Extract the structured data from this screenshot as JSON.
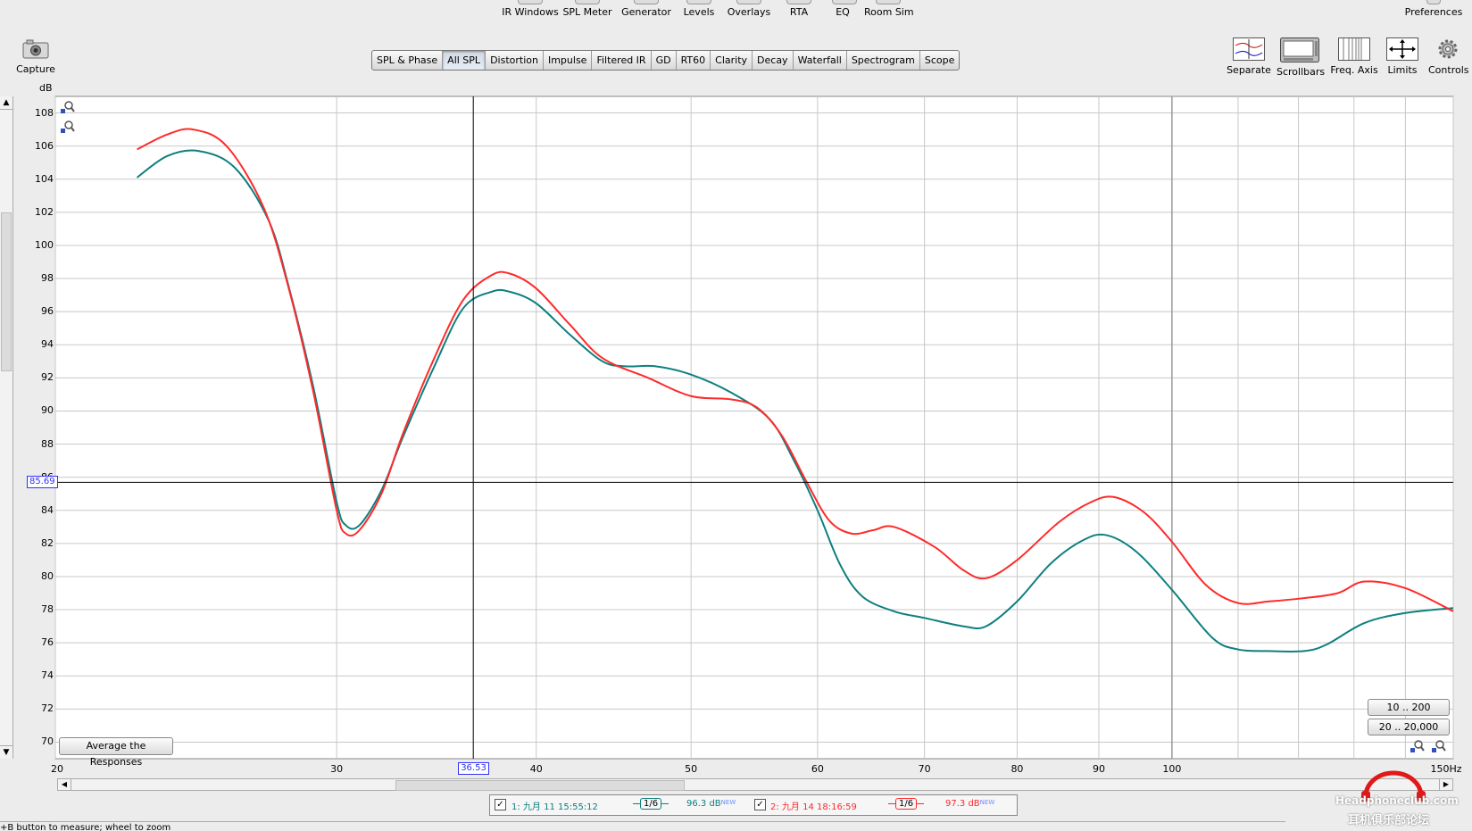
{
  "toolbar_top": {
    "items": [
      "IR Windows",
      "SPL Meter",
      "Generator",
      "Levels",
      "Overlays",
      "RTA",
      "EQ",
      "Room Sim"
    ],
    "preferences": "Preferences"
  },
  "capture_label": "Capture",
  "tabs": [
    "SPL & Phase",
    "All SPL",
    "Distortion",
    "Impulse",
    "Filtered IR",
    "GD",
    "RT60",
    "Clarity",
    "Decay",
    "Waterfall",
    "Spectrogram",
    "Scope"
  ],
  "active_tab": "All SPL",
  "right_tools": [
    "Separate",
    "Scrollbars",
    "Freq. Axis",
    "Limits",
    "Controls"
  ],
  "average_button": "Average the Responses",
  "range_buttons": [
    "10 .. 200",
    "20 .. 20,000"
  ],
  "cursor": {
    "x_readout": "36.53",
    "y_readout": "85.69",
    "x": 36.53,
    "y": 85.69
  },
  "status_text": "+B button to measure; wheel to zoom",
  "watermark": {
    "line1": "Headphoneclub.com",
    "line2": "耳机俱乐部论坛"
  },
  "legend": [
    {
      "label": "1: 九月 11 15:55:12",
      "smoothing": "1/6",
      "level": "96.3 dB",
      "tag": "NEW",
      "color": "#0e7f7f"
    },
    {
      "label": "2: 九月 14 18:16:59",
      "smoothing": "1/6",
      "level": "97.3 dB",
      "tag": "NEW",
      "color": "#ff2a2a"
    }
  ],
  "chart_data": {
    "type": "line",
    "x_scale": "log",
    "xlim": [
      20,
      150
    ],
    "ylim": [
      69,
      109
    ],
    "ylabel": "dB",
    "grid": true,
    "x_ticks": [
      {
        "v": 20,
        "label": "20"
      },
      {
        "v": 30,
        "label": "30"
      },
      {
        "v": 40,
        "label": "40"
      },
      {
        "v": 50,
        "label": "50"
      },
      {
        "v": 60,
        "label": "60"
      },
      {
        "v": 70,
        "label": "70"
      },
      {
        "v": 80,
        "label": "80"
      },
      {
        "v": 90,
        "label": "90"
      },
      {
        "v": 100,
        "label": "100"
      },
      {
        "v": 150,
        "label": "150Hz"
      }
    ],
    "y_ticks": [
      70,
      72,
      74,
      76,
      78,
      80,
      82,
      84,
      86,
      88,
      90,
      92,
      94,
      96,
      98,
      100,
      102,
      104,
      106,
      108
    ],
    "series": [
      {
        "name": "1: 九月 11 15:55:12",
        "color": "#0e7f7f",
        "points": [
          [
            22.5,
            104.1
          ],
          [
            23.5,
            105.4
          ],
          [
            24.6,
            105.7
          ],
          [
            25.9,
            104.7
          ],
          [
            27.2,
            101.5
          ],
          [
            28.0,
            97.5
          ],
          [
            29.0,
            91.5
          ],
          [
            30.0,
            84.5
          ],
          [
            30.4,
            83.1
          ],
          [
            31.0,
            83.1
          ],
          [
            32.0,
            85.2
          ],
          [
            33.0,
            88.4
          ],
          [
            34.5,
            92.6
          ],
          [
            36.0,
            96.2
          ],
          [
            37.5,
            97.2
          ],
          [
            38.5,
            97.2
          ],
          [
            40.0,
            96.5
          ],
          [
            42.0,
            94.6
          ],
          [
            44.0,
            93.0
          ],
          [
            45.5,
            92.7
          ],
          [
            47.5,
            92.7
          ],
          [
            50.0,
            92.2
          ],
          [
            53.0,
            91.1
          ],
          [
            56.0,
            89.5
          ],
          [
            58.0,
            87.0
          ],
          [
            60.0,
            84.0
          ],
          [
            62.0,
            80.7
          ],
          [
            64.0,
            78.8
          ],
          [
            67.0,
            77.9
          ],
          [
            70.0,
            77.5
          ],
          [
            74.0,
            77.0
          ],
          [
            76.5,
            77.0
          ],
          [
            80.0,
            78.5
          ],
          [
            84.0,
            80.8
          ],
          [
            88.0,
            82.2
          ],
          [
            91.0,
            82.5
          ],
          [
            95.0,
            81.5
          ],
          [
            100.0,
            79.2
          ],
          [
            106.0,
            76.3
          ],
          [
            110.0,
            75.6
          ],
          [
            115.0,
            75.5
          ],
          [
            121.0,
            75.5
          ],
          [
            125.0,
            75.9
          ],
          [
            132.0,
            77.2
          ],
          [
            140.0,
            77.8
          ],
          [
            150.0,
            78.1
          ]
        ]
      },
      {
        "name": "2: 九月 14 18:16:59",
        "color": "#ff2a2a",
        "points": [
          [
            22.5,
            105.8
          ],
          [
            23.5,
            106.7
          ],
          [
            24.4,
            107.0
          ],
          [
            25.6,
            106.0
          ],
          [
            27.0,
            102.3
          ],
          [
            28.0,
            97.4
          ],
          [
            29.0,
            91.2
          ],
          [
            30.0,
            84.0
          ],
          [
            30.4,
            82.6
          ],
          [
            31.0,
            82.8
          ],
          [
            32.0,
            85.0
          ],
          [
            33.0,
            88.6
          ],
          [
            34.5,
            93.1
          ],
          [
            36.0,
            96.7
          ],
          [
            37.5,
            98.2
          ],
          [
            38.5,
            98.3
          ],
          [
            40.0,
            97.4
          ],
          [
            42.0,
            95.2
          ],
          [
            44.0,
            93.2
          ],
          [
            47.0,
            92.0
          ],
          [
            50.0,
            90.9
          ],
          [
            53.0,
            90.7
          ],
          [
            55.0,
            90.2
          ],
          [
            57.0,
            88.5
          ],
          [
            59.0,
            85.8
          ],
          [
            61.0,
            83.4
          ],
          [
            63.0,
            82.6
          ],
          [
            65.0,
            82.8
          ],
          [
            67.0,
            83.0
          ],
          [
            71.0,
            81.8
          ],
          [
            74.0,
            80.4
          ],
          [
            76.5,
            79.9
          ],
          [
            80.0,
            81.0
          ],
          [
            85.0,
            83.3
          ],
          [
            89.0,
            84.5
          ],
          [
            92.0,
            84.8
          ],
          [
            96.0,
            83.9
          ],
          [
            100.0,
            82.1
          ],
          [
            105.0,
            79.5
          ],
          [
            110.0,
            78.4
          ],
          [
            115.0,
            78.5
          ],
          [
            121.0,
            78.7
          ],
          [
            127.0,
            79.0
          ],
          [
            132.0,
            79.7
          ],
          [
            140.0,
            79.3
          ],
          [
            150.0,
            77.9
          ]
        ]
      }
    ]
  }
}
